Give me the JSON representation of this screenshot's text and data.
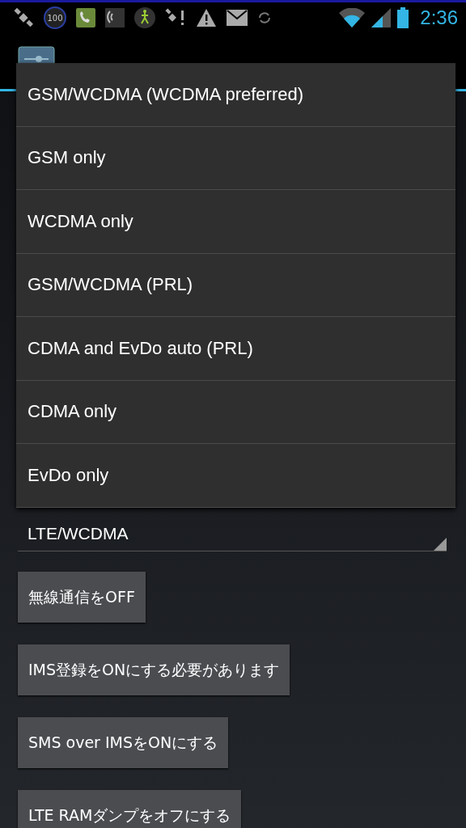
{
  "status_bar": {
    "time": "2:36",
    "battery_icon_badge": "100"
  },
  "network_spinner": {
    "value": "LTE/WCDMA"
  },
  "buttons": [
    "無線通信をOFF",
    "IMS登録をONにする必要があります",
    "SMS over IMSをONにする",
    "LTE RAMダンプをオフにする"
  ],
  "dropdown": {
    "options": [
      {
        "label": "GSM/WCDMA (WCDMA preferred)"
      },
      {
        "label": "GSM only"
      },
      {
        "label": "WCDMA only"
      },
      {
        "label": "GSM/WCDMA (PRL)"
      },
      {
        "label": "CDMA and EvDo auto (PRL)"
      },
      {
        "label": "CDMA only"
      },
      {
        "label": "EvDo only"
      }
    ]
  }
}
